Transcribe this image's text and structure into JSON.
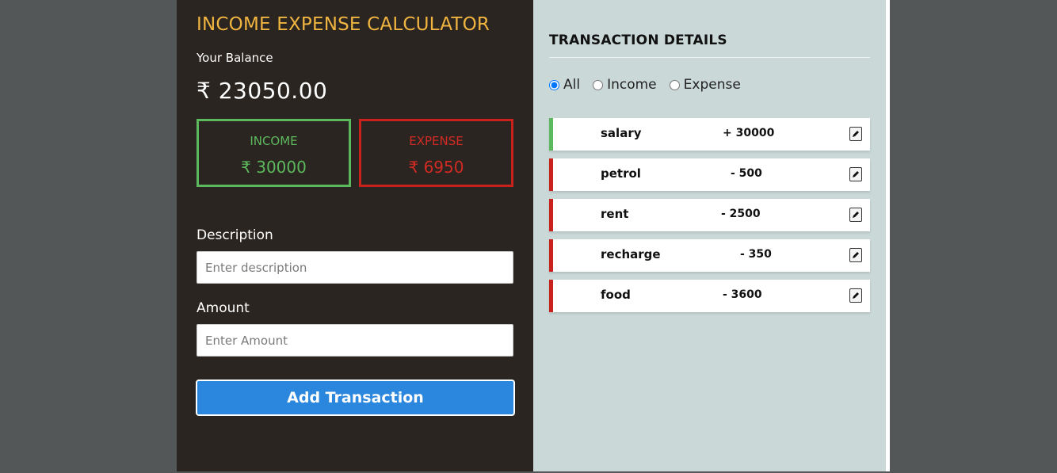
{
  "calculator": {
    "title": "INCOME EXPENSE CALCULATOR",
    "balance_label": "Your Balance",
    "balance_value": "₹ 23050.00",
    "income_card": {
      "label": "INCOME",
      "value": "₹ 30000"
    },
    "expense_card": {
      "label": "EXPENSE",
      "value": "₹ 6950"
    },
    "form": {
      "description_label": "Description",
      "description_placeholder": "Enter description",
      "description_value": "",
      "amount_label": "Amount",
      "amount_placeholder": "Enter Amount",
      "amount_value": "",
      "submit_label": "Add Transaction"
    }
  },
  "details": {
    "title": "TRANSACTION DETAILS",
    "filters": [
      {
        "label": "All",
        "checked": true
      },
      {
        "label": "Income",
        "checked": false
      },
      {
        "label": "Expense",
        "checked": false
      }
    ],
    "transactions": [
      {
        "name": "salary",
        "amount": "+ 30000",
        "type": "income"
      },
      {
        "name": "petrol",
        "amount": "- 500",
        "type": "expense"
      },
      {
        "name": "rent",
        "amount": "- 2500",
        "type": "expense"
      },
      {
        "name": "recharge",
        "amount": "- 350",
        "type": "expense"
      },
      {
        "name": "food",
        "amount": "- 3600",
        "type": "expense"
      }
    ]
  },
  "colors": {
    "title_accent": "#f0b440",
    "income": "#5cb85c",
    "expense": "#c9221c",
    "button": "#2b86dd",
    "left_panel_bg": "#2b2521",
    "right_panel_bg": "#cad9d8"
  },
  "icons": {
    "edit": "pencil-icon"
  }
}
